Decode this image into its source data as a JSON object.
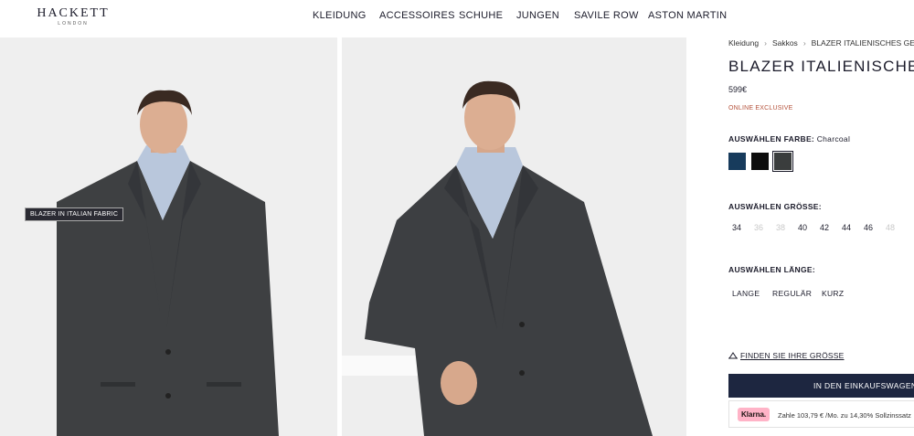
{
  "header": {
    "logo": "HACKETT",
    "logo_sub": "LONDON",
    "nav": [
      "KLEIDUNG",
      "ACCESSOIRES",
      "SCHUHE",
      "JUNGEN",
      "SAVILE ROW",
      "ASTON MARTIN"
    ]
  },
  "gallery": {
    "badge": "BLAZER IN ITALIAN FABRIC"
  },
  "product": {
    "breadcrumb": [
      "Kleidung",
      "Sakkos",
      "BLAZER ITALIENISCHES GEWEBE"
    ],
    "title": "BLAZER ITALIENISCHES GEWEBE",
    "price": "599€",
    "exclusive": "ONLINE EXCLUSIVE",
    "color_label": "AUSWÄHLEN FARBE:",
    "color_value": "Charcoal",
    "swatches": [
      {
        "name": "navy",
        "color": "#173b5c"
      },
      {
        "name": "black",
        "color": "#0d0d0d"
      },
      {
        "name": "charcoal",
        "color": "#3a3d3d",
        "selected": true
      }
    ],
    "size_label": "AUSWÄHLEN GRÖSSE:",
    "sizes": [
      {
        "label": "34",
        "available": true
      },
      {
        "label": "36",
        "available": false
      },
      {
        "label": "38",
        "available": false
      },
      {
        "label": "40",
        "available": true
      },
      {
        "label": "42",
        "available": true
      },
      {
        "label": "44",
        "available": true
      },
      {
        "label": "46",
        "available": true
      },
      {
        "label": "48",
        "available": false
      }
    ],
    "length_label": "AUSWÄHLEN LÄNGE:",
    "lengths": [
      "LANGE",
      "REGULÄR",
      "KURZ"
    ],
    "find_size": "FINDEN SIE IHRE GRÖSSE",
    "cart_button": "IN DEN EINKAUFSWAGEN",
    "klarna_logo": "Klarna.",
    "klarna_text": "Zahle 103,79 € /Mo. zu 14,30% Sollzinssatz"
  },
  "colors": {
    "brand_dark": "#1d2640",
    "accent": "#b5533c",
    "klarna_pink": "#ffb3c7"
  }
}
